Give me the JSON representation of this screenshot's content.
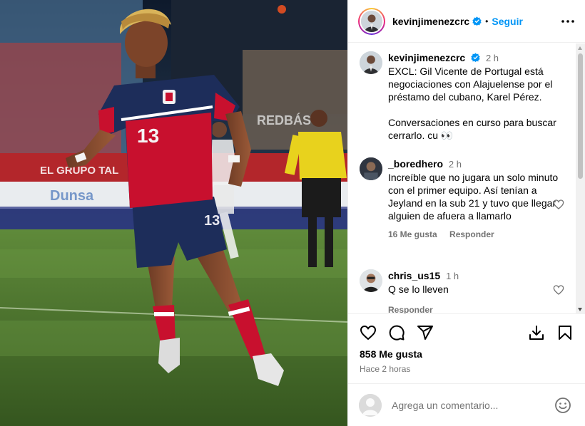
{
  "post": {
    "username": "kevinjimenezcrc",
    "separator": "•",
    "follow_label": "Seguir",
    "caption": {
      "time": "2 h",
      "text": "EXCL: Gil Vicente de Portugal está negociaciones con Alajuelense por el préstamo del cubano, Karel Pérez.\n\nConversaciones en curso para buscar cerrarlo. cu 👀"
    },
    "photo": {
      "jersey_number": "13",
      "banner_left": "EL GRUPO TAL",
      "banner_right": "REDBÁS",
      "board": "Dunsa"
    }
  },
  "comments": [
    {
      "username": "_boredhero",
      "time": "2 h",
      "text": "Increíble que no jugara un solo minuto con el primer equipo. Así tenían a Jeyland en la sub 21 y tuvo que llegar alguien de afuera a llamarlo",
      "likes_label": "16 Me gusta",
      "reply_label": "Responder"
    },
    {
      "username": "chris_us15",
      "time": "1 h",
      "text": "Q se lo lleven",
      "reply_label": "Responder"
    }
  ],
  "stats": {
    "likes": "858 Me gusta",
    "posted": "Hace 2 horas"
  },
  "composer": {
    "placeholder": "Agrega un comentario..."
  },
  "colors": {
    "accent": "#0095f6",
    "verified": "#0095f6",
    "muted": "#737373",
    "jersey_red": "#c8102e",
    "jersey_navy": "#1d2d5a"
  },
  "icons": [
    "more-options-icon",
    "verified-icon",
    "heart-icon",
    "comment-icon",
    "share-icon",
    "save-icon",
    "bookmark-icon",
    "emoji-icon"
  ]
}
